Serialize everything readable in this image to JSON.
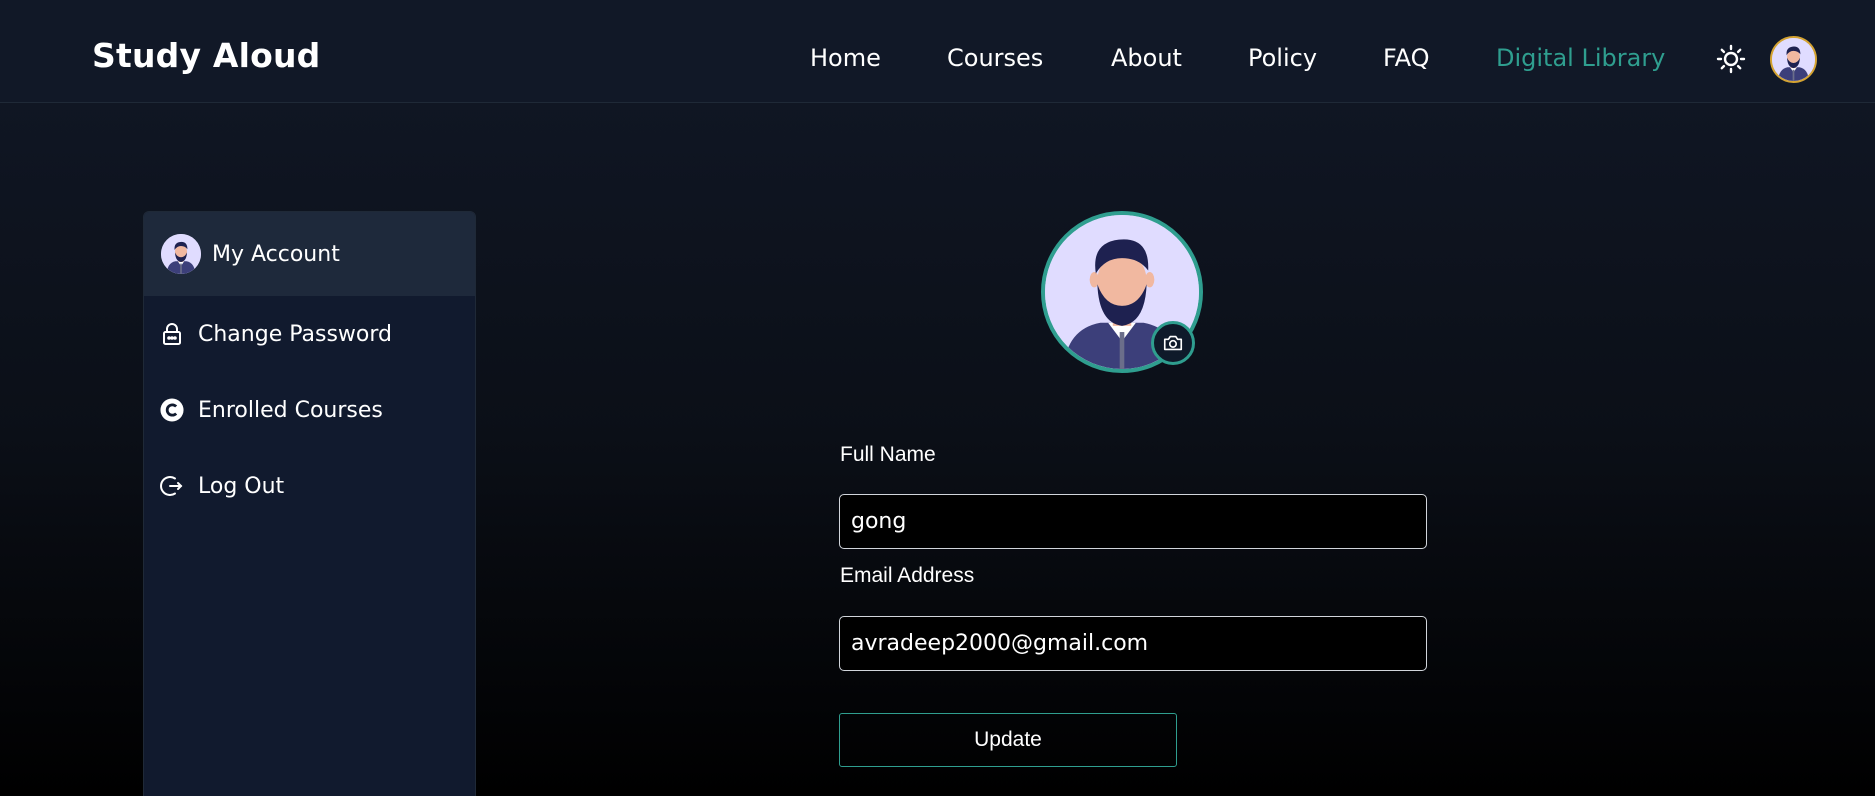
{
  "brand": "Study Aloud",
  "nav": {
    "links": [
      "Home",
      "Courses",
      "About",
      "Policy",
      "FAQ",
      "Digital Library"
    ],
    "active": "Digital Library",
    "theme_icon": "sun-icon",
    "avatar_icon": "user-avatar-icon"
  },
  "sidebar": {
    "items": [
      {
        "label": "My Account",
        "icon": "avatar-icon",
        "active": true
      },
      {
        "label": "Change Password",
        "icon": "lock-icon"
      },
      {
        "label": "Enrolled Courses",
        "icon": "copyright-icon"
      },
      {
        "label": "Log Out",
        "icon": "logout-icon"
      }
    ]
  },
  "profile": {
    "camera_icon": "camera-icon"
  },
  "form": {
    "full_name_label": "Full Name",
    "full_name_value": "gong",
    "email_label": "Email Address",
    "email_value": "avradeep2000@gmail.com",
    "update_label": "Update"
  },
  "colors": {
    "accent": "#2f9e8f",
    "nav_bg": "#111827",
    "sidebar_bg": "#111a2e",
    "sidebar_active_bg": "#1e293b",
    "avatar_ring": "#d4a332"
  }
}
